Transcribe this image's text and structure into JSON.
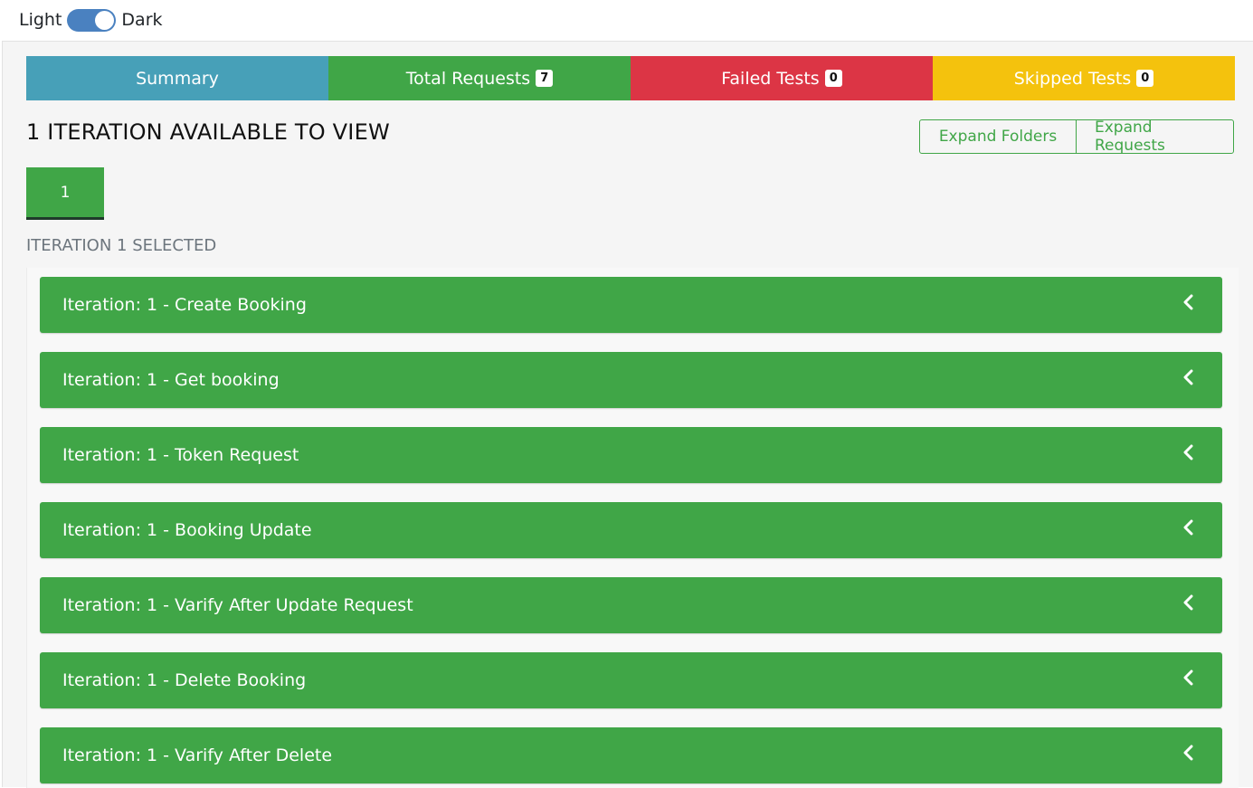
{
  "theme": {
    "light_label": "Light",
    "dark_label": "Dark"
  },
  "tabs": [
    {
      "label": "Summary",
      "badge": ""
    },
    {
      "label": "Total Requests",
      "badge": "7"
    },
    {
      "label": "Failed Tests",
      "badge": "0"
    },
    {
      "label": "Skipped Tests",
      "badge": "0"
    }
  ],
  "heading": "1 ITERATION AVAILABLE TO VIEW",
  "buttons": {
    "expand_folders": "Expand Folders",
    "expand_requests": "Expand Requests"
  },
  "iterations": [
    "1"
  ],
  "selected_label": "ITERATION 1 SELECTED",
  "requests": [
    "Iteration: 1 - Create Booking",
    "Iteration: 1 - Get booking",
    "Iteration: 1 - Token Request",
    "Iteration: 1 - Booking Update",
    "Iteration: 1 - Varify After Update Request",
    "Iteration: 1 - Delete Booking",
    "Iteration: 1 - Varify After Delete"
  ],
  "colors": {
    "summary": "#47a0b8",
    "success": "#40a647",
    "danger": "#dc3545",
    "warning": "#f4c20d",
    "toggle": "#4a81c0"
  }
}
